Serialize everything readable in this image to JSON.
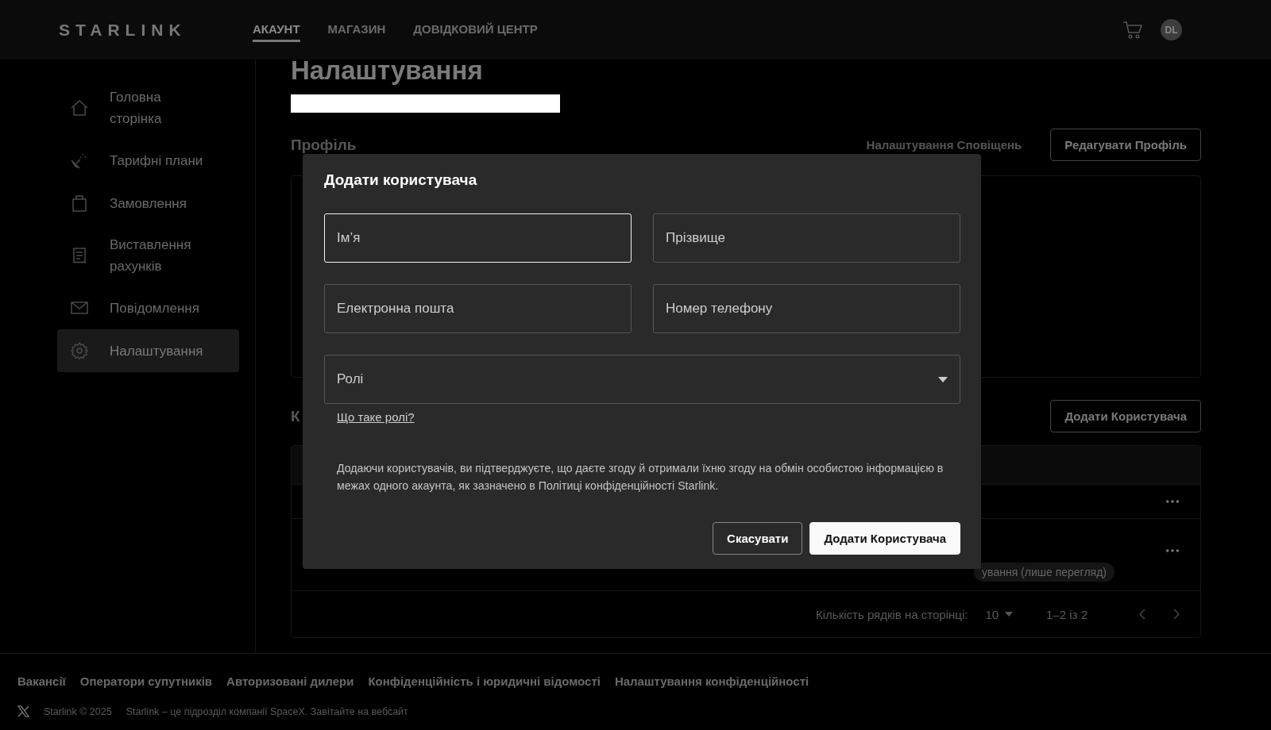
{
  "header": {
    "logo": "STARLINK",
    "nav": [
      {
        "label": "АКАУНТ",
        "selected": true
      },
      {
        "label": "МАГАЗИН",
        "selected": false
      },
      {
        "label": "ДОВІДКОВИЙ ЦЕНТР",
        "selected": false
      }
    ],
    "avatar": "DL"
  },
  "sidebar": {
    "items": [
      {
        "label": "Головна сторінка",
        "kind": "home",
        "selected": false
      },
      {
        "label": "Тарифні плани",
        "kind": "satellite",
        "selected": false
      },
      {
        "label": "Замовлення",
        "kind": "bag",
        "selected": false
      },
      {
        "label": "Виставлення рахунків",
        "kind": "receipt",
        "selected": false
      },
      {
        "label": "Повідомлення",
        "kind": "mail",
        "selected": false
      },
      {
        "label": "Налаштування",
        "kind": "gear",
        "selected": true
      }
    ]
  },
  "page": {
    "title": "Налаштування",
    "profile": {
      "heading": "Профіль",
      "notifications_link": "Налаштування Сповіщень",
      "edit_button": "Редагувати Профіль"
    },
    "users": {
      "heading": "К",
      "add_button": "Додати Користувача",
      "rows": [
        {
          "kind": "plain"
        },
        {
          "kind": "tagged",
          "tag": "ування (лише перегляд)"
        }
      ],
      "pagination": {
        "rows_label": "Кількість рядків на сторінці:",
        "rows_per_page": "10",
        "range": "1–2 із 2"
      }
    }
  },
  "modal": {
    "title": "Додати користувача",
    "fields": [
      {
        "placeholder": "Ім’я",
        "focused": true
      },
      {
        "placeholder": "Прізвище",
        "focused": false
      },
      {
        "placeholder": "Електронна пошта",
        "focused": false
      },
      {
        "placeholder": "Номер телефону",
        "focused": false
      }
    ],
    "roles": {
      "placeholder": "Ролі"
    },
    "roles_link": "Що таке ролі?",
    "disclaimer": "Додаючи користувачів, ви підтверджуєте, що даєте згоду й отримали їхню згоду на обмін особистою інформацією в межах одного акаунта, як зазначено в Політиці конфіденційності Starlink.",
    "buttons": [
      {
        "label": "Скасувати",
        "kind": "secondary"
      },
      {
        "label": "Додати Користувача",
        "kind": "primary"
      }
    ]
  },
  "footer": {
    "links": [
      "Вакансії",
      "Оператори супутників",
      "Авторизовані дилери",
      "Конфіденційність і юридичні відомості",
      "Налаштування конфіденційності"
    ],
    "copyright": "Starlink © 2025",
    "tagline": "Starlink – це підрозділ компанії SpaceX. Завітайте на вебсайт"
  }
}
